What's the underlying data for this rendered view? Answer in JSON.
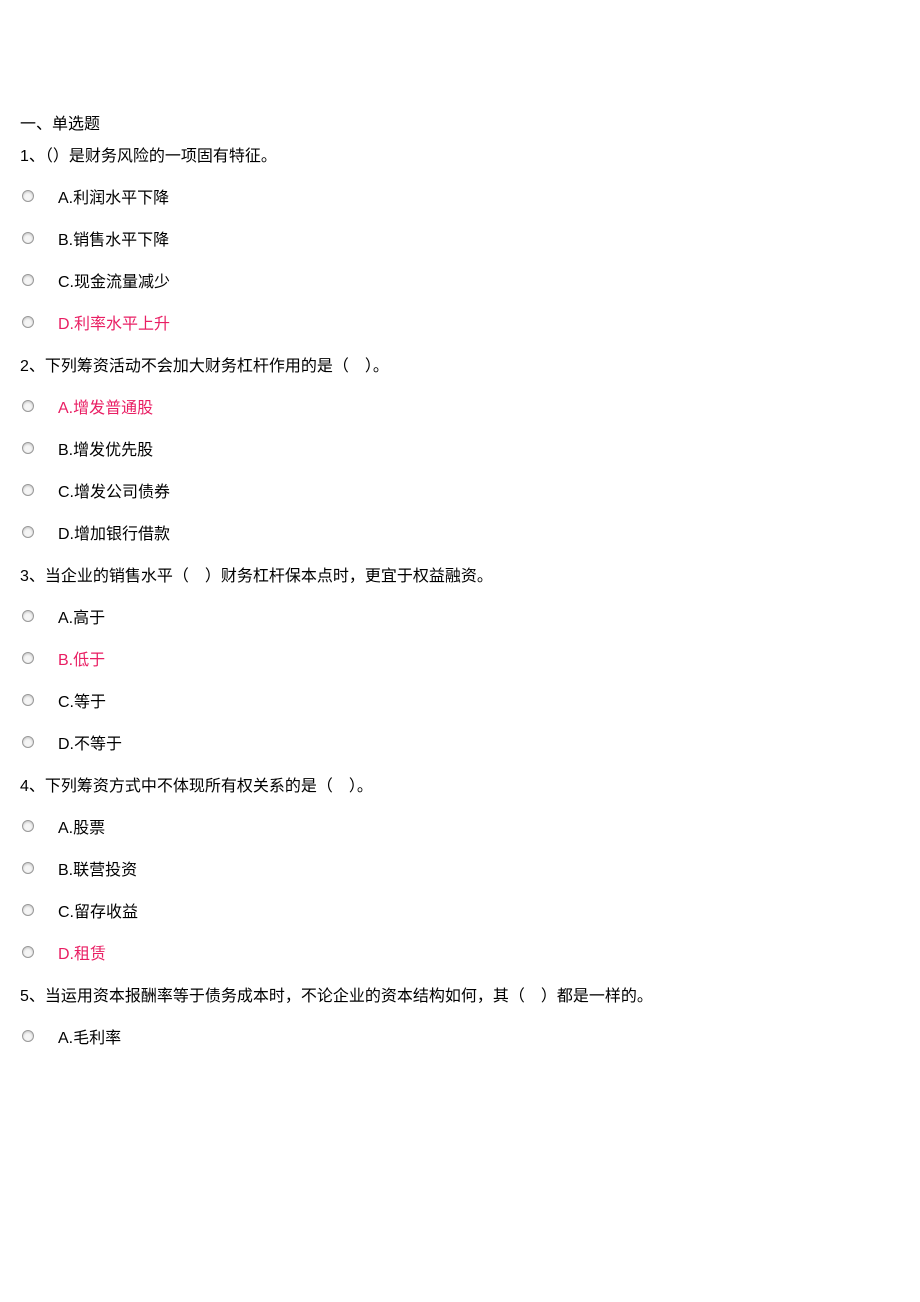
{
  "section_title": "一、单选题",
  "questions": [
    {
      "stem": "1、（）是财务风险的一项固有特征。",
      "options": [
        {
          "text": "A.利润水平下降",
          "highlight": false
        },
        {
          "text": "B.销售水平下降",
          "highlight": false
        },
        {
          "text": "C.现金流量减少",
          "highlight": false
        },
        {
          "text": "D.利率水平上升",
          "highlight": true
        }
      ]
    },
    {
      "stem": "2、下列筹资活动不会加大财务杠杆作用的是（　）。",
      "options": [
        {
          "text": "A.增发普通股",
          "highlight": true
        },
        {
          "text": "B.增发优先股",
          "highlight": false
        },
        {
          "text": "C.增发公司债券",
          "highlight": false
        },
        {
          "text": "D.增加银行借款",
          "highlight": false
        }
      ]
    },
    {
      "stem": "3、当企业的销售水平（　）财务杠杆保本点时，更宜于权益融资。",
      "options": [
        {
          "text": "A.高于",
          "highlight": false
        },
        {
          "text": "B.低于",
          "highlight": true
        },
        {
          "text": "C.等于",
          "highlight": false
        },
        {
          "text": "D.不等于",
          "highlight": false
        }
      ]
    },
    {
      "stem": "4、下列筹资方式中不体现所有权关系的是（　）。",
      "options": [
        {
          "text": "A.股票",
          "highlight": false
        },
        {
          "text": "B.联营投资",
          "highlight": false
        },
        {
          "text": "C.留存收益",
          "highlight": false
        },
        {
          "text": "D.租赁",
          "highlight": true
        }
      ]
    },
    {
      "stem": "5、当运用资本报酬率等于债务成本时，不论企业的资本结构如何，其（　）都是一样的。",
      "options": [
        {
          "text": "A.毛利率",
          "highlight": false
        }
      ]
    }
  ]
}
